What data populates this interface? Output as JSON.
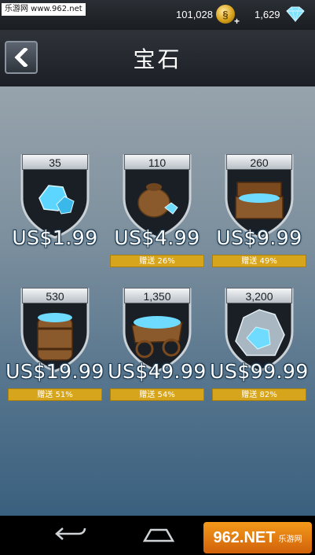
{
  "watermark_top": "乐游网 www.962.net",
  "status": {
    "coins": "101,028",
    "gems": "1,629",
    "coin_icon": "gold-coin-icon",
    "gem_icon": "diamond-icon"
  },
  "header": {
    "title": "宝石",
    "back_icon": "chevron-left-icon"
  },
  "products": [
    {
      "amount": "35",
      "price": "US$1.99",
      "bonus": "",
      "icon": "gem-pile-icon"
    },
    {
      "amount": "110",
      "price": "US$4.99",
      "bonus": "赠送 26%",
      "icon": "gem-sack-icon"
    },
    {
      "amount": "260",
      "price": "US$9.99",
      "bonus": "赠送 49%",
      "icon": "gem-chest-icon"
    },
    {
      "amount": "530",
      "price": "US$19.99",
      "bonus": "赠送 51%",
      "icon": "gem-barrel-icon"
    },
    {
      "amount": "1,350",
      "price": "US$49.99",
      "bonus": "赠送 54%",
      "icon": "gem-cart-icon"
    },
    {
      "amount": "3,200",
      "price": "US$99.99",
      "bonus": "赠送 82%",
      "icon": "gem-heap-icon"
    }
  ],
  "navbar": {
    "back_icon": "nav-back-icon",
    "home_icon": "nav-home-icon"
  },
  "watermark_br": {
    "main": "962.NET",
    "sub": "乐游网"
  }
}
